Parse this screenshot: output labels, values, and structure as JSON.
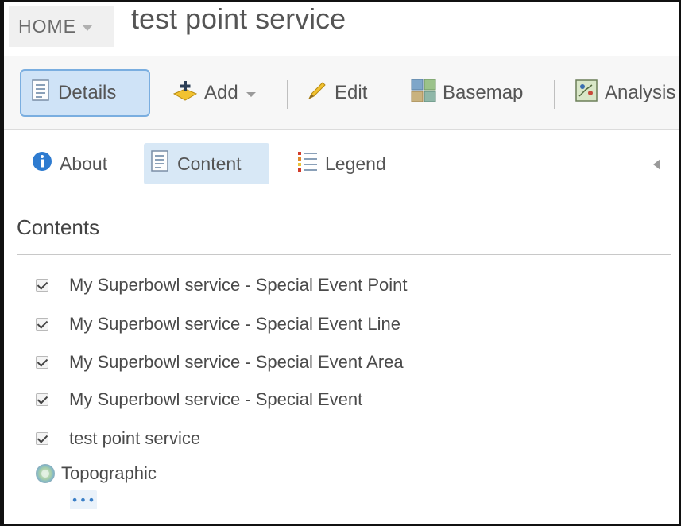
{
  "header": {
    "home_label": "HOME",
    "map_title": "test point service"
  },
  "toolbar": {
    "details_label": "Details",
    "add_label": "Add",
    "edit_label": "Edit",
    "basemap_label": "Basemap",
    "analysis_label": "Analysis"
  },
  "pane_tabs": {
    "about_label": "About",
    "content_label": "Content",
    "legend_label": "Legend"
  },
  "contents": {
    "title": "Contents",
    "layers": [
      {
        "label": "My Superbowl service - Special Event Point",
        "checked": true
      },
      {
        "label": "My Superbowl service - Special Event Line",
        "checked": true
      },
      {
        "label": "My Superbowl service - Special Event Area",
        "checked": true
      },
      {
        "label": "My Superbowl service - Special Event",
        "checked": true
      },
      {
        "label": "test point service",
        "checked": true
      }
    ],
    "basemap_label": "Topographic",
    "more_label": "•••"
  },
  "colors": {
    "active_button_bg": "#cfe3f7",
    "active_button_border": "#7aaee0",
    "info_icon": "#2e7bd0",
    "toolbar_bg": "#f7f7f7"
  },
  "icons": {
    "details": "details-list-icon",
    "add": "add-plus-icon",
    "edit": "pencil-icon",
    "basemap": "basemap-grid-icon",
    "analysis": "analysis-map-icon",
    "about": "info-icon",
    "content": "content-list-icon",
    "legend": "legend-list-icon",
    "basemap_layer": "globe-icon"
  }
}
